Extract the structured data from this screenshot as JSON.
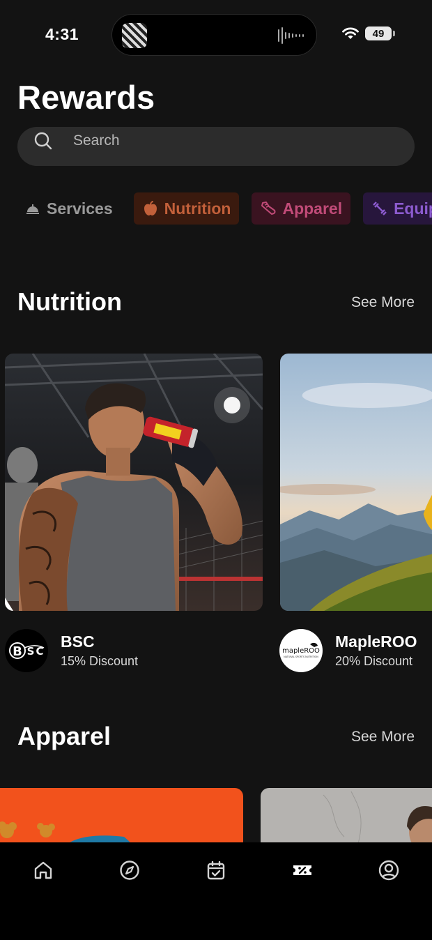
{
  "status": {
    "time": "4:31",
    "battery": "49"
  },
  "header": {
    "title": "Rewards"
  },
  "search": {
    "placeholder": "Search"
  },
  "categories": [
    {
      "label": "Services",
      "icon": "bell-icon"
    },
    {
      "label": "Nutrition",
      "icon": "apple-icon"
    },
    {
      "label": "Apparel",
      "icon": "shoe-icon"
    },
    {
      "label": "Equipment",
      "icon": "dumbbell-icon"
    }
  ],
  "sections": [
    {
      "title": "Nutrition",
      "see_more": "See More",
      "items": [
        {
          "brand": "BSC",
          "discount": "15% Discount"
        },
        {
          "brand": "MapleROO",
          "discount": "20% Discount",
          "logo_text": "mapleROO",
          "logo_sub": "NATURAL SPORTS NUTRITION"
        }
      ]
    },
    {
      "title": "Apparel",
      "see_more": "See More"
    }
  ],
  "tabbar": [
    {
      "icon": "home-icon"
    },
    {
      "icon": "compass-icon"
    },
    {
      "icon": "calendar-check-icon"
    },
    {
      "icon": "ticket-percent-icon"
    },
    {
      "icon": "profile-icon"
    }
  ],
  "colors": {
    "background": "#131313",
    "nutrition": "#c2603a",
    "apparel": "#c14b78",
    "equipment": "#8c5bcf"
  }
}
